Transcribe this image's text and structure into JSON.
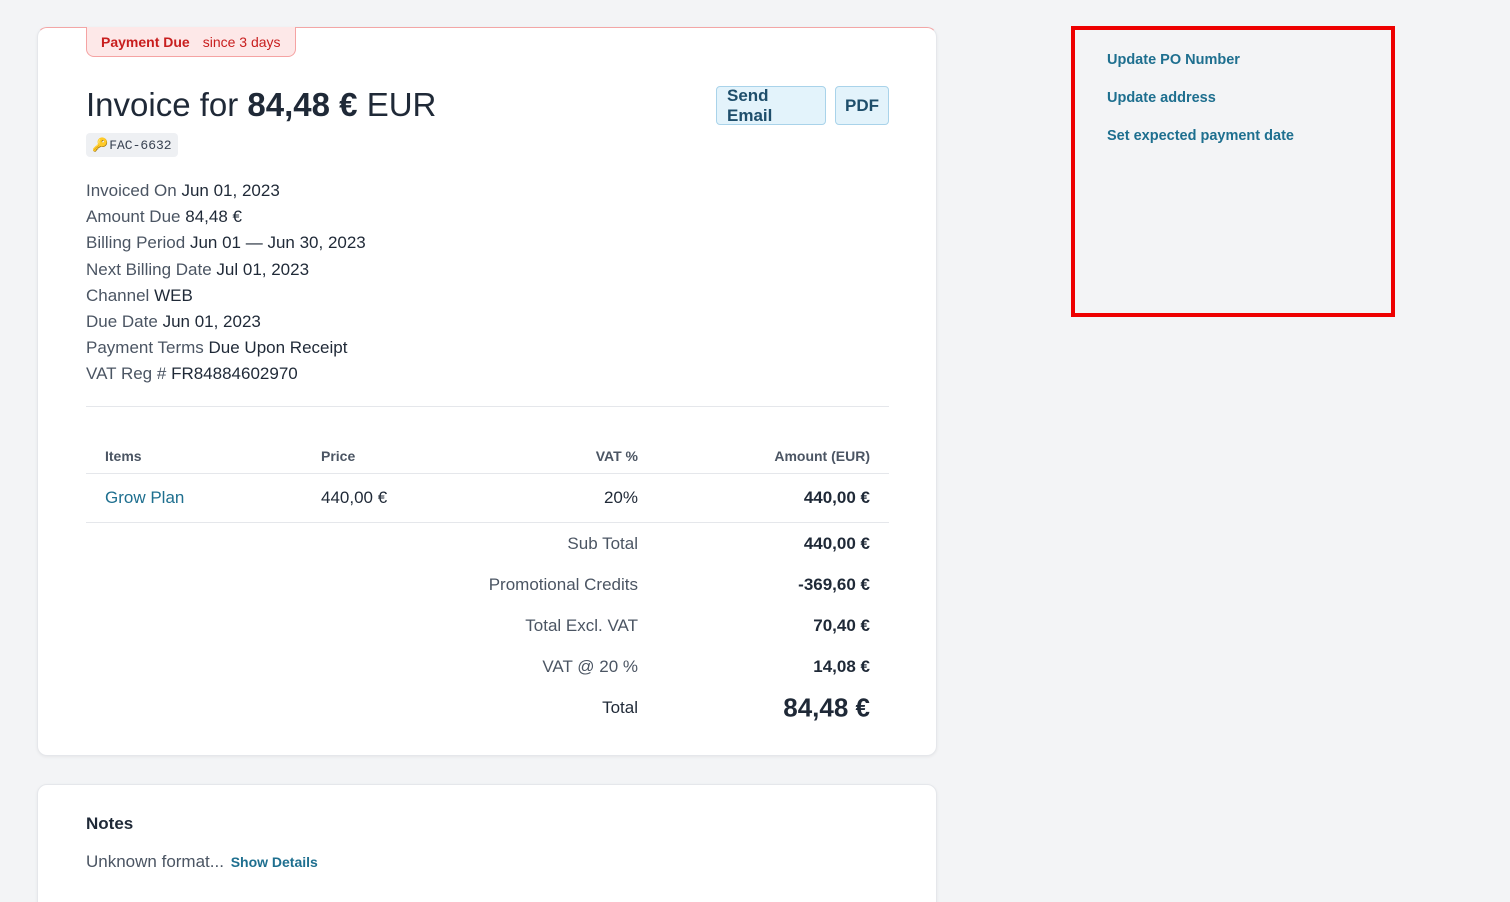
{
  "invoice": {
    "status": "Payment Due",
    "status_since": "since 3 days",
    "title_prefix": "Invoice for",
    "title_amount": "84,48 €",
    "title_currency": "EUR",
    "reference": "FAC-6632",
    "buttons": {
      "send_email": "Send Email",
      "pdf": "PDF"
    },
    "meta": [
      {
        "label": "Invoiced On",
        "value": "Jun 01, 2023"
      },
      {
        "label": "Amount Due",
        "value": "84,48 €"
      },
      {
        "label": "Billing Period",
        "value": "Jun 01 — Jun 30, 2023"
      },
      {
        "label": "Next Billing Date",
        "value": "Jul 01, 2023"
      },
      {
        "label": "Channel",
        "value": "WEB"
      },
      {
        "label": "Due Date",
        "value": "Jun 01, 2023"
      },
      {
        "label": "Payment Terms",
        "value": "Due Upon Receipt"
      },
      {
        "label": "VAT Reg #",
        "value": "FR84884602970"
      }
    ],
    "table": {
      "headers": {
        "items": "Items",
        "price": "Price",
        "vat": "VAT %",
        "amount": "Amount (EUR)"
      },
      "rows": [
        {
          "item": "Grow Plan",
          "price": "440,00 €",
          "vat": "20%",
          "amount": "440,00 €"
        }
      ],
      "summary": [
        {
          "label": "Sub Total",
          "value": "440,00 €"
        },
        {
          "label": "Promotional Credits",
          "value": "-369,60 €"
        },
        {
          "label": "Total Excl. VAT",
          "value": "70,40 €"
        },
        {
          "label": "VAT @ 20 %",
          "value": "14,08 €"
        }
      ],
      "total": {
        "label": "Total",
        "value": "84,48 €"
      }
    }
  },
  "notes": {
    "title": "Notes",
    "text": "Unknown format...",
    "show_details": "Show Details"
  },
  "actions": [
    {
      "label": "Update PO Number"
    },
    {
      "label": "Update address"
    },
    {
      "label": "Set expected payment date"
    }
  ],
  "colors": {
    "accent_link": "#1e6f8f",
    "due_badge": "#c81e1e",
    "highlight_box": "#ee0000"
  }
}
